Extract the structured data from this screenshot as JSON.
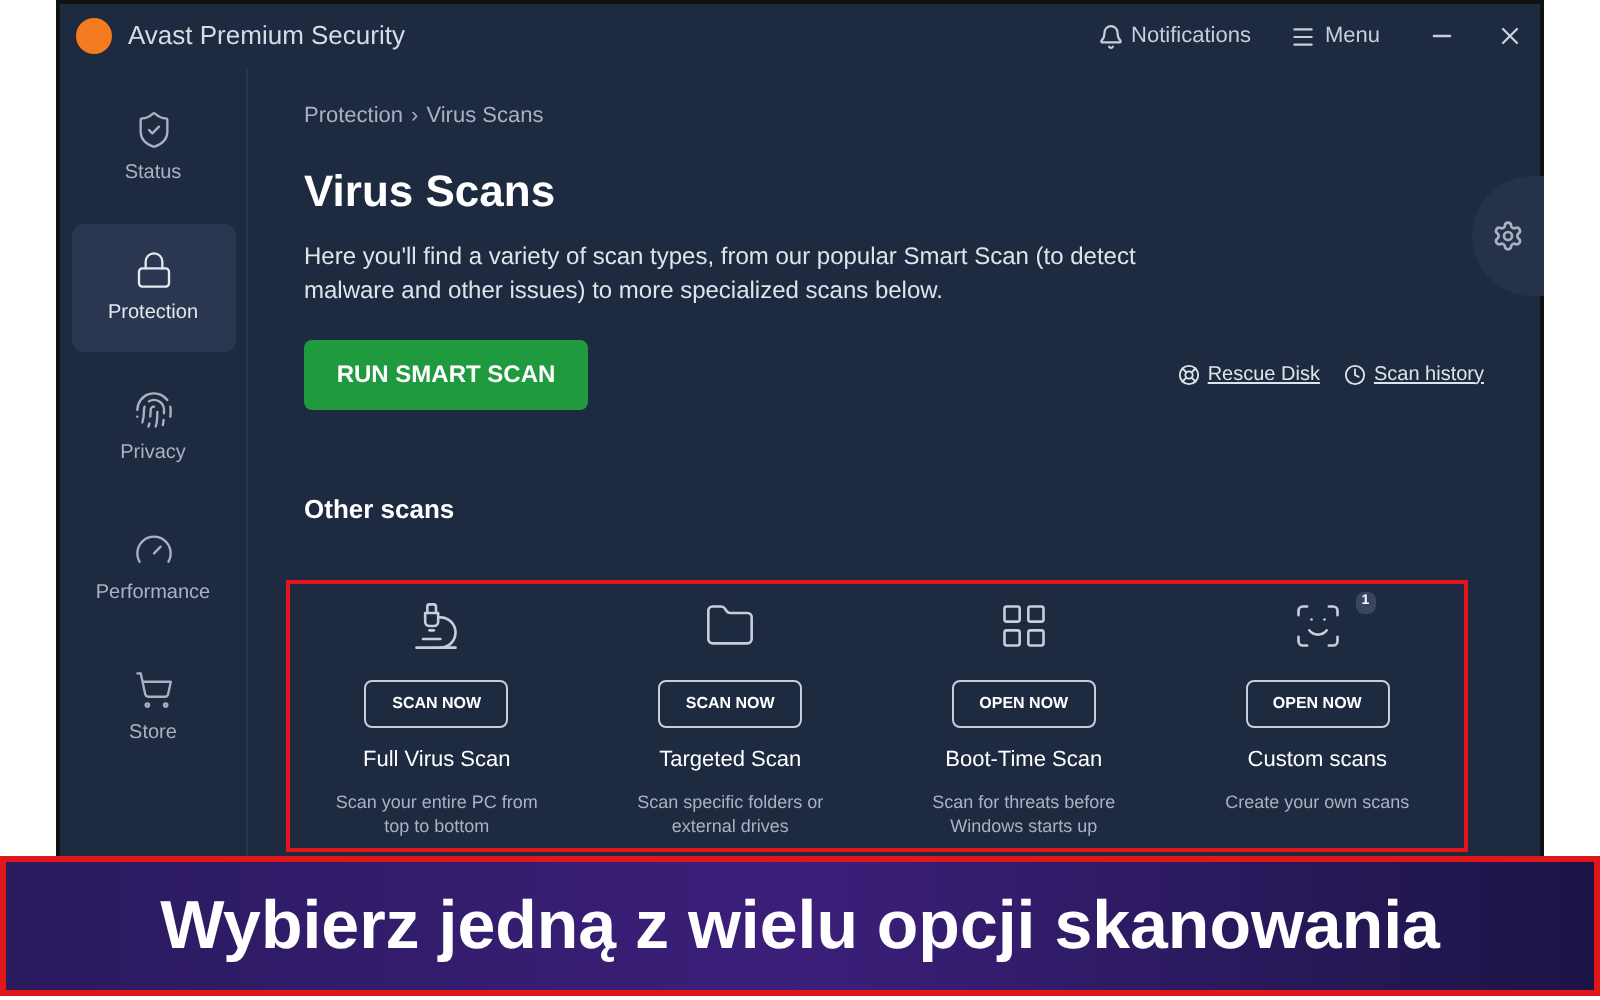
{
  "window": {
    "title": "Avast Premium Security",
    "notifications": "Notifications",
    "menu": "Menu"
  },
  "sidebar": {
    "items": [
      {
        "label": "Status",
        "kind": "status",
        "selected": false
      },
      {
        "label": "Protection",
        "kind": "lock",
        "selected": true
      },
      {
        "label": "Privacy",
        "kind": "fingerprint",
        "selected": false
      },
      {
        "label": "Performance",
        "kind": "gauge",
        "selected": false
      },
      {
        "label": "Store",
        "kind": "cart",
        "selected": false
      }
    ]
  },
  "breadcrumb": [
    "Protection",
    "›",
    "Virus Scans"
  ],
  "title": "Virus Scans",
  "description": "Here you'll find a variety of scan types, from our popular Smart Scan (to detect malware and other issues) to more specialized scans below.",
  "primary_button": "RUN SMART SCAN",
  "links": [
    {
      "label": "Rescue Disk",
      "kind": "lifebuoy"
    },
    {
      "label": "Scan history",
      "kind": "clock"
    }
  ],
  "section_title": "Other scans",
  "scans": [
    {
      "kind": "microscope",
      "button": "SCAN NOW",
      "name": "Full Virus Scan",
      "text": "Scan your entire PC from top to bottom"
    },
    {
      "kind": "folder",
      "button": "SCAN NOW",
      "name": "Targeted Scan",
      "text": "Scan specific folders or external drives"
    },
    {
      "kind": "windows",
      "button": "OPEN NOW",
      "name": "Boot-Time Scan",
      "text": "Scan for threats before Windows starts up"
    },
    {
      "kind": "custom",
      "button": "OPEN NOW",
      "name": "Custom scans",
      "text": "Create your own scans",
      "badge": "1"
    }
  ],
  "caption": "Wybierz jedną z wielu opcji skanowania"
}
